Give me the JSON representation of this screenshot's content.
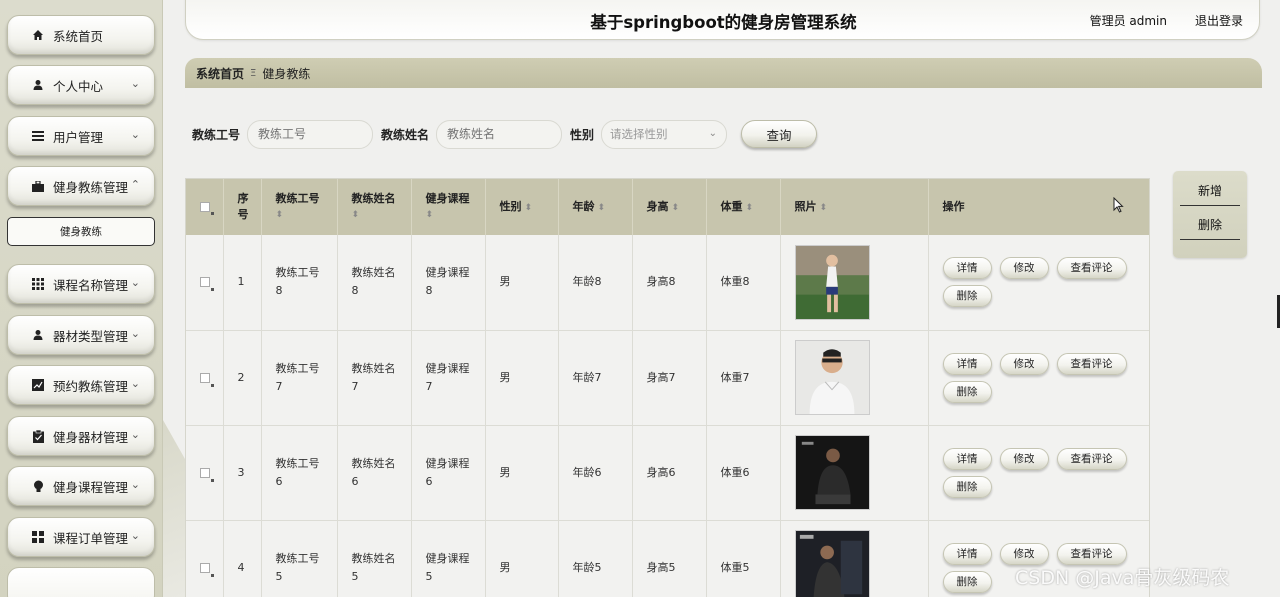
{
  "sidebar": {
    "items": [
      {
        "label": "系统首页",
        "icon": "home-icon",
        "has_arrow": false
      },
      {
        "label": "个人中心",
        "icon": "person-icon",
        "has_arrow": true
      },
      {
        "label": "用户管理",
        "icon": "list-icon",
        "has_arrow": true
      },
      {
        "label": "健身教练管理",
        "icon": "briefcase-icon",
        "has_arrow": true,
        "expanded": true
      },
      {
        "label": "课程名称管理",
        "icon": "grid-icon",
        "has_arrow": true
      },
      {
        "label": "器材类型管理",
        "icon": "person-icon",
        "has_arrow": true
      },
      {
        "label": "预约教练管理",
        "icon": "chart-icon",
        "has_arrow": true
      },
      {
        "label": "健身器材管理",
        "icon": "clipboard-icon",
        "has_arrow": true
      },
      {
        "label": "健身课程管理",
        "icon": "bulb-icon",
        "has_arrow": true
      },
      {
        "label": "课程订单管理",
        "icon": "apps-icon",
        "has_arrow": true
      }
    ],
    "submenu": {
      "label": "健身教练"
    }
  },
  "header": {
    "title": "基于springboot的健身房管理系统",
    "user": "管理员 admin",
    "logout": "退出登录"
  },
  "breadcrumb": {
    "home": "系统首页",
    "separator": "Ξ",
    "current": "健身教练"
  },
  "search": {
    "fields": [
      {
        "label": "教练工号",
        "placeholder": "教练工号"
      },
      {
        "label": "教练姓名",
        "placeholder": "教练姓名"
      }
    ],
    "gender_label": "性别",
    "gender_placeholder": "请选择性别",
    "query_button": "查询"
  },
  "actions": {
    "add": "新增",
    "delete": "删除"
  },
  "table": {
    "columns": {
      "index": "序号",
      "coach_id": "教练工号",
      "coach_name": "教练姓名",
      "course": "健身课程",
      "gender": "性别",
      "age": "年龄",
      "height": "身高",
      "weight": "体重",
      "photo": "照片",
      "ops": "操作"
    },
    "rows": [
      {
        "index": "1",
        "coach_id": "教练工号8",
        "coach_name": "教练姓名8",
        "course": "健身课程8",
        "gender": "男",
        "age": "年龄8",
        "height": "身高8",
        "weight": "体重8"
      },
      {
        "index": "2",
        "coach_id": "教练工号7",
        "coach_name": "教练姓名7",
        "course": "健身课程7",
        "gender": "男",
        "age": "年龄7",
        "height": "身高7",
        "weight": "体重7"
      },
      {
        "index": "3",
        "coach_id": "教练工号6",
        "coach_name": "教练姓名6",
        "course": "健身课程6",
        "gender": "男",
        "age": "年龄6",
        "height": "身高6",
        "weight": "体重6"
      },
      {
        "index": "4",
        "coach_id": "教练工号5",
        "coach_name": "教练姓名5",
        "course": "健身课程5",
        "gender": "男",
        "age": "年龄5",
        "height": "身高5",
        "weight": "体重5"
      }
    ],
    "op_buttons": {
      "detail": "详情",
      "edit": "修改",
      "reviews": "查看评论",
      "delete": "删除"
    }
  },
  "watermark": "CSDN @Java骨灰级码农",
  "colors": {
    "sidebar_bg": "#d7d7c5",
    "header_band": "#c7c5ad",
    "page_bg": "#f0f0ee"
  }
}
